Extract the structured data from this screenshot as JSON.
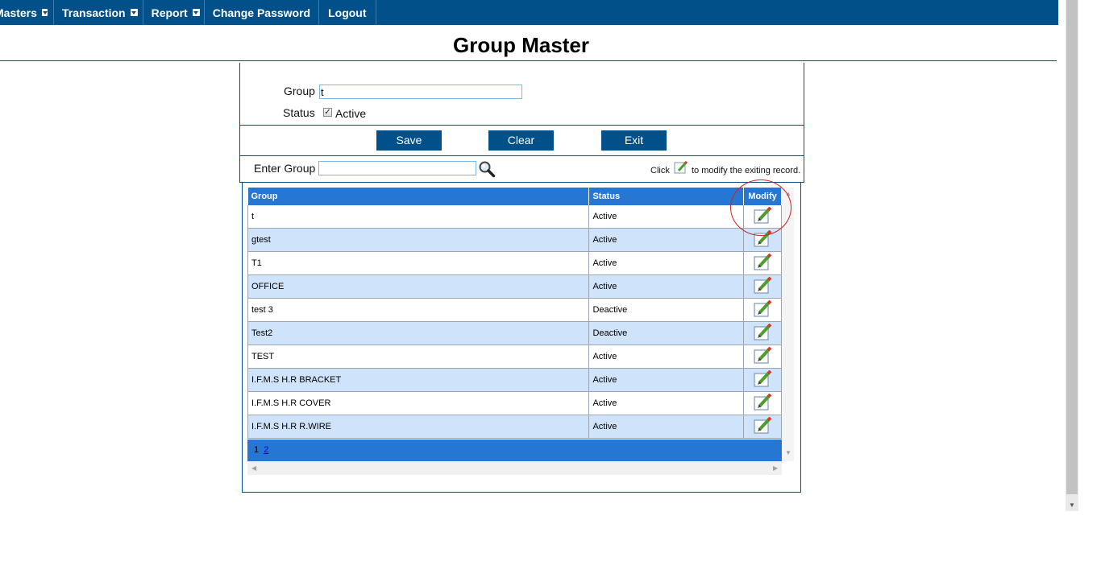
{
  "nav": {
    "items": [
      {
        "label": "Masters",
        "has_dropdown": true
      },
      {
        "label": "Transaction",
        "has_dropdown": true
      },
      {
        "label": "Report",
        "has_dropdown": true
      },
      {
        "label": "Change Password",
        "has_dropdown": false
      },
      {
        "label": "Logout",
        "has_dropdown": false
      }
    ]
  },
  "page": {
    "title": "Group Master"
  },
  "form": {
    "group_label": "Group",
    "group_value": "t",
    "status_label": "Status",
    "active_label": "Active",
    "active_checked": true
  },
  "buttons": {
    "save": "Save",
    "clear": "Clear",
    "exit": "Exit"
  },
  "search": {
    "label": "Enter Group",
    "value": "",
    "hint_prefix": "Click",
    "hint_suffix": "to modify the exiting record."
  },
  "grid": {
    "columns": [
      "Group",
      "Status",
      "Modify"
    ],
    "rows": [
      {
        "group": "t",
        "status": "Active"
      },
      {
        "group": "gtest",
        "status": "Active"
      },
      {
        "group": "T1",
        "status": "Active"
      },
      {
        "group": "OFFICE",
        "status": "Active"
      },
      {
        "group": "test 3",
        "status": "Deactive"
      },
      {
        "group": "Test2",
        "status": "Deactive"
      },
      {
        "group": "TEST",
        "status": "Active"
      },
      {
        "group": "I.F.M.S H.R BRACKET",
        "status": "Active"
      },
      {
        "group": "I.F.M.S H.R COVER",
        "status": "Active"
      },
      {
        "group": "I.F.M.S H.R R.WIRE",
        "status": "Active"
      }
    ],
    "pager": {
      "current": "1",
      "pages": [
        "2"
      ]
    }
  },
  "colors": {
    "nav_bg": "#02508a",
    "grid_header": "#2677d4",
    "row_alt": "#cfe3fb",
    "highlight": "#d02020"
  }
}
